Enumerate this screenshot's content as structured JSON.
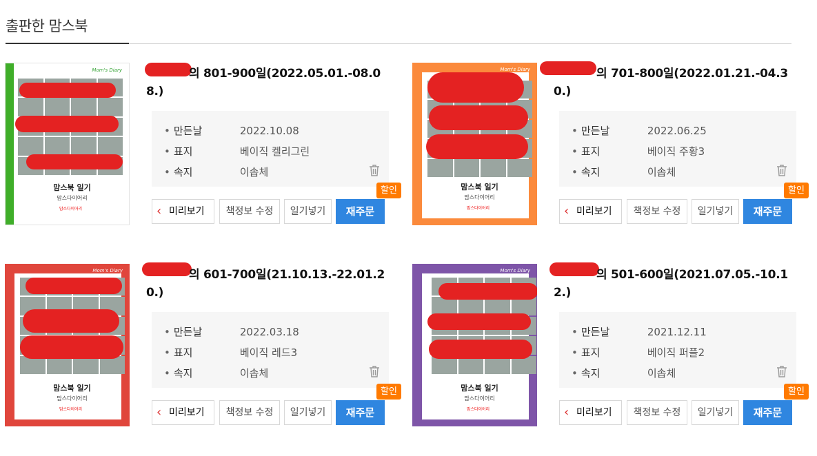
{
  "header": {
    "title": "출판한 맘스북"
  },
  "labels": {
    "created": "만든날",
    "cover": "표지",
    "paper": "속지",
    "bullet": "•"
  },
  "buttons": {
    "preview": "미리보기",
    "edit": "책정보 수정",
    "insert": "일기넣기",
    "reorder": "재주문",
    "badge": "할인"
  },
  "cover_text": {
    "brand": "Mom's Diary",
    "title": "맘스북 일기",
    "subtitle": "맘스다이어리",
    "logo": "맘스다이어리"
  },
  "books": [
    {
      "title": "의 801-900일(2022.05.01.-08.08.)",
      "created": "2022.10.08",
      "cover": "베이직 켈리그린",
      "paper": "이솝체",
      "color": "#3fae29"
    },
    {
      "title": "의 701-800일(2022.01.21.-04.30.)",
      "created": "2022.06.25",
      "cover": "베이직 주황3",
      "paper": "이솝체",
      "color": "#fb8a3c"
    },
    {
      "title": "의 601-700일(21.10.13.-22.01.20.)",
      "created": "2022.03.18",
      "cover": "베이직 레드3",
      "paper": "이솝체",
      "color": "#e0463c"
    },
    {
      "title": "의 501-600일(2021.07.05.-10.12.)",
      "created": "2021.12.11",
      "cover": "베이직 퍼플2",
      "paper": "이솝체",
      "color": "#7e55a8"
    }
  ]
}
